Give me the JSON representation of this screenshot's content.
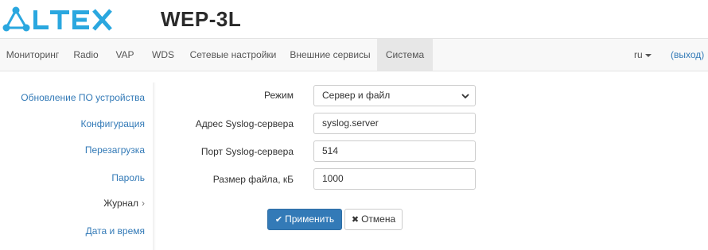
{
  "header": {
    "product": "WEP-3L",
    "brand_color": "#2aa7df"
  },
  "navbar": {
    "items": [
      {
        "label": "Мониторинг"
      },
      {
        "label": "Radio"
      },
      {
        "label": "VAP"
      },
      {
        "label": "WDS"
      },
      {
        "label": "Сетевые настройки"
      },
      {
        "label": "Внешние сервисы"
      },
      {
        "label": "Система",
        "active": true
      }
    ],
    "language": "ru",
    "logout": "(выход)"
  },
  "sidebar": {
    "items": [
      {
        "label": "Обновление ПО устройства"
      },
      {
        "label": "Конфигурация"
      },
      {
        "label": "Перезагрузка"
      },
      {
        "label": "Пароль"
      },
      {
        "label": "Журнал",
        "current": true
      },
      {
        "label": "Дата и время"
      }
    ]
  },
  "form": {
    "mode": {
      "label": "Режим",
      "value": "Сервер и файл"
    },
    "syslog_address": {
      "label": "Адрес Syslog-сервера",
      "value": "syslog.server"
    },
    "syslog_port": {
      "label": "Порт Syslog-сервера",
      "value": "514"
    },
    "file_size": {
      "label": "Размер файла, кБ",
      "value": "1000"
    }
  },
  "actions": {
    "apply": "Применить",
    "cancel": "Отмена"
  },
  "colors": {
    "primary": "#337ab7",
    "link": "#337ab7",
    "navbar_bg": "#f8f8f8",
    "navbar_active_bg": "#e7e7e7"
  }
}
